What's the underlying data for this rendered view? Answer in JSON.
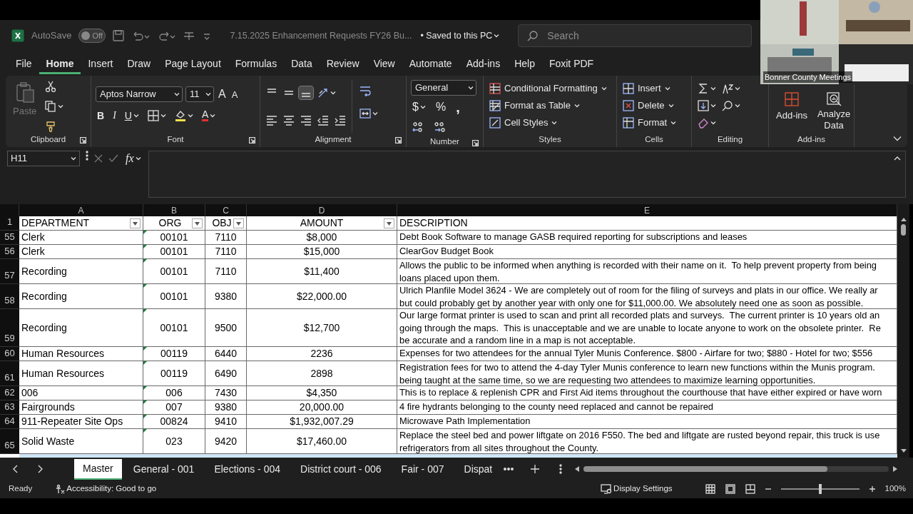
{
  "title_bar": {
    "autosave_label": "AutoSave",
    "autosave": {
      "on": false,
      "label": "Off"
    },
    "document_title": "7.15.2025 Enhancement Requests FY26 Bu...",
    "save_status": "• Saved to this PC",
    "search": {
      "placeholder": "Search"
    }
  },
  "menu_tabs": [
    {
      "label": "File",
      "selected": false
    },
    {
      "label": "Home",
      "selected": true
    },
    {
      "label": "Insert",
      "selected": false
    },
    {
      "label": "Draw",
      "selected": false
    },
    {
      "label": "Page Layout",
      "selected": false
    },
    {
      "label": "Formulas",
      "selected": false
    },
    {
      "label": "Data",
      "selected": false
    },
    {
      "label": "Review",
      "selected": false
    },
    {
      "label": "View",
      "selected": false
    },
    {
      "label": "Automate",
      "selected": false
    },
    {
      "label": "Add-ins",
      "selected": false
    },
    {
      "label": "Help",
      "selected": false
    },
    {
      "label": "Foxit PDF",
      "selected": false
    }
  ],
  "ribbon": {
    "clipboard": {
      "paste": {
        "label": "Paste",
        "disabled": true
      },
      "label": "Clipboard"
    },
    "font": {
      "font_name": "Aptos Narrow",
      "font_size": "11",
      "grow": "A",
      "shrink": "A",
      "styles": [
        "B",
        "I",
        "U"
      ],
      "font_color": "A",
      "label": "Font"
    },
    "alignment": {
      "vertical": [
        {
          "selected": false
        },
        {
          "selected": false
        },
        {
          "selected": true
        }
      ],
      "label": "Alignment"
    },
    "number": {
      "format": "General",
      "symbols": [
        "$",
        "%",
        ","
      ],
      "label": "Number"
    },
    "styles": {
      "commands": [
        "Conditional Formatting",
        "Format as Table",
        "Cell Styles"
      ],
      "label": "Styles"
    },
    "cells": {
      "commands": [
        "Insert",
        "Delete",
        "Format"
      ],
      "label": "Cells"
    },
    "editing": {
      "label": "Editing"
    },
    "add_ins": {
      "buttons": [
        "Add-ins",
        "Analyze Data"
      ],
      "label": "Add-ins"
    }
  },
  "formula_bar": {
    "name_box": "H11",
    "function_label": "fx"
  },
  "sheet": {
    "columns": [
      {
        "letter": "A",
        "header": "DEPARTMENT",
        "filter": true
      },
      {
        "letter": "B",
        "header": "ORG",
        "filter": true
      },
      {
        "letter": "C",
        "header": "OBJ",
        "filter": true
      },
      {
        "letter": "D",
        "header": "AMOUNT",
        "filter": true
      },
      {
        "letter": "E",
        "header": "DESCRIPTION",
        "filter": false
      }
    ],
    "header_row": "1",
    "rows": [
      {
        "number": "55",
        "department": "Clerk",
        "org": "00101",
        "obj": "7110",
        "amount": "$8,000",
        "description": [
          "Debt Book Software to manage GASB required reporting for subscriptions and leases"
        ]
      },
      {
        "number": "56",
        "department": "Clerk",
        "org": "00101",
        "obj": "7110",
        "amount": "$15,000",
        "description": [
          "ClearGov Budget Book"
        ]
      },
      {
        "number": "57",
        "department": "Recording",
        "org": "00101",
        "obj": "7110",
        "amount": "$11,400",
        "description": [
          "Allows the public to be informed when anything is recorded with their name on it.  To help prevent property from being",
          "loans placed upon them."
        ]
      },
      {
        "number": "58",
        "department": "Recording",
        "org": "00101",
        "obj": "9380",
        "amount": "$22,000.00",
        "description": [
          "Ulrich Planfile Model 3624 - We are completely out of room for the filing of surveys and plats in our office. We really ar",
          "but could probably get by another year with only one for $11,000.00. We absolutely need one as soon as possible."
        ]
      },
      {
        "number": "59",
        "department": "Recording",
        "org": "00101",
        "obj": "9500",
        "amount": "$12,700",
        "description": [
          "Our large format printer is used to scan and print all recorded plats and surveys.  The current printer is 10 years old an",
          "going through the maps.  This is unacceptable and we are unable to locate anyone to work on the obsolete printer.  Re",
          "be accurate and a random line in a map is not acceptable."
        ]
      },
      {
        "number": "60",
        "department": "Human Resources",
        "org": "00119",
        "obj": "6440",
        "amount": "2236",
        "description": [
          "Expenses for two attendees for the annual Tyler Munis Conference. $800 - Airfare for two; $880 - Hotel for two; $556"
        ]
      },
      {
        "number": "61",
        "department": "Human Resources",
        "org": "00119",
        "obj": "6490",
        "amount": "2898",
        "description": [
          "Registration fees for two to attend the 4-day Tyler Munis conference to learn new functions within the Munis program.",
          "being taught at the same time, so we are requesting two attendees to maximize learning opportunities."
        ]
      },
      {
        "number": "62",
        "department": "006",
        "org": "006",
        "obj": "7430",
        "amount": "$4,350",
        "description": [
          "This is to replace & replenish CPR and First Aid items throughout the courthouse that have either expired or have worn"
        ]
      },
      {
        "number": "63",
        "department": "Fairgrounds",
        "org": "007",
        "obj": "9380",
        "amount": "20,000.00",
        "description": [
          "4 fire hydrants belonging to the county need replaced and cannot be repaired"
        ]
      },
      {
        "number": "64",
        "department": "911-Repeater Site Ops",
        "org": "00824",
        "obj": "9410",
        "amount": "$1,932,007.29",
        "description": [
          "Microwave Path Implementation"
        ]
      },
      {
        "number": "65",
        "department": "Solid Waste",
        "org": "023",
        "obj": "9420",
        "amount": "$17,460.00",
        "description": [
          "Replace the steel bed and power liftgate on 2016 F550. The bed and liftgate are rusted beyond repair, this truck is use",
          "refrigerators from all sites throughout the County."
        ]
      }
    ]
  },
  "sheet_tabs": [
    {
      "label": "Master",
      "selected": true
    },
    {
      "label": "General - 001",
      "selected": false
    },
    {
      "label": "Elections - 004",
      "selected": false
    },
    {
      "label": "District court - 006",
      "selected": false
    },
    {
      "label": "Fair - 007",
      "selected": false
    },
    {
      "label": "Dispat",
      "selected": false
    }
  ],
  "status_bar": {
    "mode": "Ready",
    "accessibility": "Accessibility: Good to go",
    "display_settings": "Display Settings",
    "zoom": {
      "level": 0.5,
      "reading": "100%"
    }
  },
  "video_overlay": {
    "label": "Bonner County Meetings"
  }
}
